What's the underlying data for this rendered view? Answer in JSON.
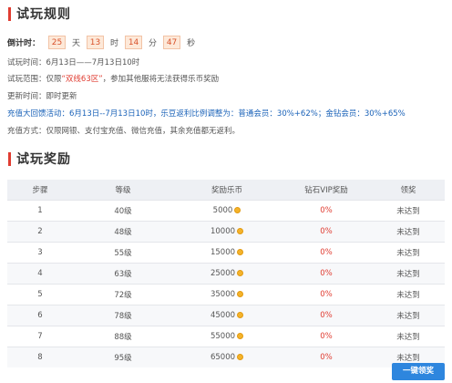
{
  "rules": {
    "title": "试玩规则",
    "countdown": {
      "label": "倒计时：",
      "days": "25",
      "days_unit": "天",
      "hours": "13",
      "hours_unit": "时",
      "minutes": "14",
      "minutes_unit": "分",
      "seconds": "47",
      "seconds_unit": "秒"
    },
    "time_line": "试玩时间：6月13日——7月13日10时",
    "scope_prefix": "试玩范围：仅限",
    "scope_zone": "“双线63区”",
    "scope_suffix": "，参加其他服将无法获得乐币奖励",
    "update_line": "更新时间：即时更新",
    "charge_prefix": "充值大回馈活动：6月13日--7月13日10时，乐豆返利比例调整为：",
    "charge_normal": "普通会员：30%+62%",
    "charge_sep": "；",
    "charge_gold": "金钻会员：30%+65%",
    "method_line": "充值方式：仅限网银、支付宝充值、微信充值，其余充值都无返利。"
  },
  "rewards": {
    "title": "试玩奖励",
    "headers": [
      "步骤",
      "等级",
      "奖励乐币",
      "钻石VIP奖励",
      "领奖"
    ],
    "rows": [
      {
        "step": "1",
        "level": "40级",
        "coins": "5000",
        "vip": "0%",
        "status": "未达到"
      },
      {
        "step": "2",
        "level": "48级",
        "coins": "10000",
        "vip": "0%",
        "status": "未达到"
      },
      {
        "step": "3",
        "level": "55级",
        "coins": "15000",
        "vip": "0%",
        "status": "未达到"
      },
      {
        "step": "4",
        "level": "63级",
        "coins": "25000",
        "vip": "0%",
        "status": "未达到"
      },
      {
        "step": "5",
        "level": "72级",
        "coins": "35000",
        "vip": "0%",
        "status": "未达到"
      },
      {
        "step": "6",
        "level": "78级",
        "coins": "45000",
        "vip": "0%",
        "status": "未达到"
      },
      {
        "step": "7",
        "level": "88级",
        "coins": "55000",
        "vip": "0%",
        "status": "未达到"
      },
      {
        "step": "8",
        "level": "95级",
        "coins": "65000",
        "vip": "0%",
        "status": "未达到"
      }
    ],
    "claim_all_label": "一键领奖"
  },
  "colors": {
    "accent_red": "#e03c31",
    "link_blue": "#1a62b8",
    "button_blue": "#2e86de",
    "coin_gold": "#f4b32b"
  },
  "icons": {
    "coin": "coin-icon"
  }
}
